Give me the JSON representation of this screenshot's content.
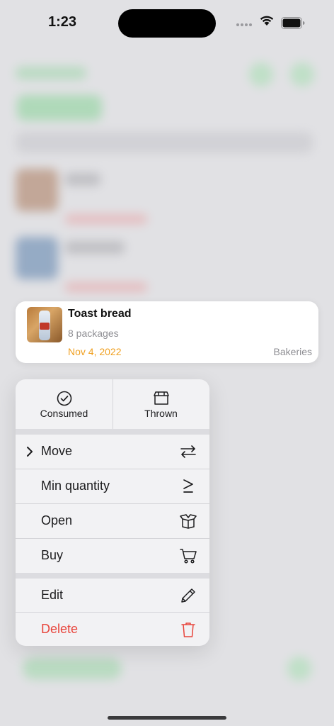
{
  "status_bar": {
    "time": "1:23"
  },
  "preview_card": {
    "title": "Toast bread",
    "quantity": "8 packages",
    "date": "Nov 4, 2022",
    "category": "Bakeries",
    "date_color": "#f0a020"
  },
  "context_menu": {
    "top_actions": [
      {
        "label": "Consumed",
        "icon": "checkmark-circle-icon"
      },
      {
        "label": "Thrown",
        "icon": "dumpster-icon"
      }
    ],
    "items": [
      {
        "label": "Move",
        "icon": "arrows-left-right-icon",
        "has_submenu": true
      },
      {
        "label": "Min quantity",
        "icon": "greater-than-or-equal-icon"
      },
      {
        "label": "Open",
        "icon": "open-box-icon"
      },
      {
        "label": "Buy",
        "icon": "cart-icon"
      },
      {
        "label": "Edit",
        "icon": "pencil-icon"
      },
      {
        "label": "Delete",
        "icon": "trash-icon",
        "destructive": true
      }
    ],
    "destructive_color": "#e8453c"
  }
}
